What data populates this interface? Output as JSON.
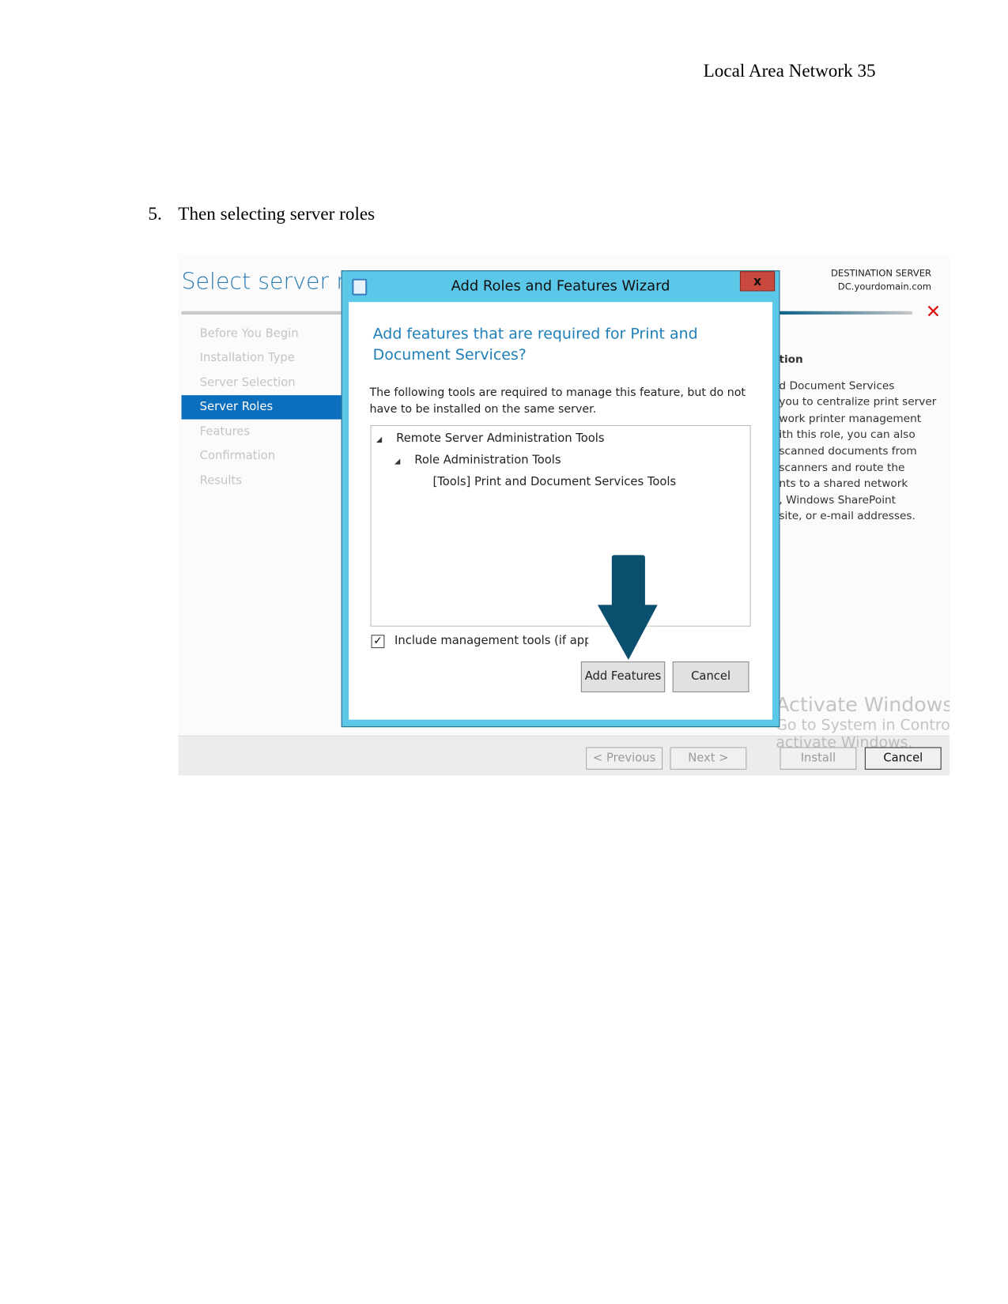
{
  "header": {
    "running_head": "Local Area Network 35"
  },
  "step": {
    "number": "5.",
    "text": "Then selecting server roles"
  },
  "screenshot": {
    "page_title": "Select server ro",
    "destination_label": "DESTINATION SERVER",
    "destination_server": "DC.yourdomain.com",
    "nav": [
      {
        "label": "Before You Begin"
      },
      {
        "label": "Installation Type"
      },
      {
        "label": "Server Selection"
      },
      {
        "label": "Server Roles",
        "active": true
      },
      {
        "label": "Features"
      },
      {
        "label": "Confirmation"
      },
      {
        "label": "Results"
      }
    ],
    "description": {
      "heading": "tion",
      "lines": [
        "d Document Services",
        "you to centralize print server",
        "work printer management",
        "ith this role, you can also",
        "scanned documents from",
        " scanners and route the",
        "nts to a shared network",
        ", Windows SharePoint",
        " site, or e-mail addresses."
      ]
    },
    "footer": {
      "previous": "< Previous",
      "next": "Next >",
      "install": "Install",
      "cancel": "Cancel"
    },
    "watermark": {
      "line1": "Activate Windows",
      "line2": "Go to System in Control Pa",
      "line3": "activate Windows."
    },
    "dialog": {
      "title": "Add Roles and Features Wizard",
      "close": "x",
      "question": "Add features that are required for Print and Document Services?",
      "info": "The following tools are required to manage this feature, but do not have to be installed on the same server.",
      "tree": [
        {
          "label": "Remote Server Administration Tools",
          "expanded": true
        },
        {
          "label": "Role Administration Tools",
          "expanded": true
        },
        {
          "label": "[Tools] Print and Document Services Tools"
        }
      ],
      "checkbox": {
        "label": "Include management tools (if applic",
        "checked": true
      },
      "add_features": "Add Features",
      "cancel": "Cancel"
    },
    "colors": {
      "accent": "#0b6fbd",
      "dialog_frame": "#5bc8ea",
      "arrow": "#0b4f6e",
      "close": "#c9493f"
    }
  }
}
